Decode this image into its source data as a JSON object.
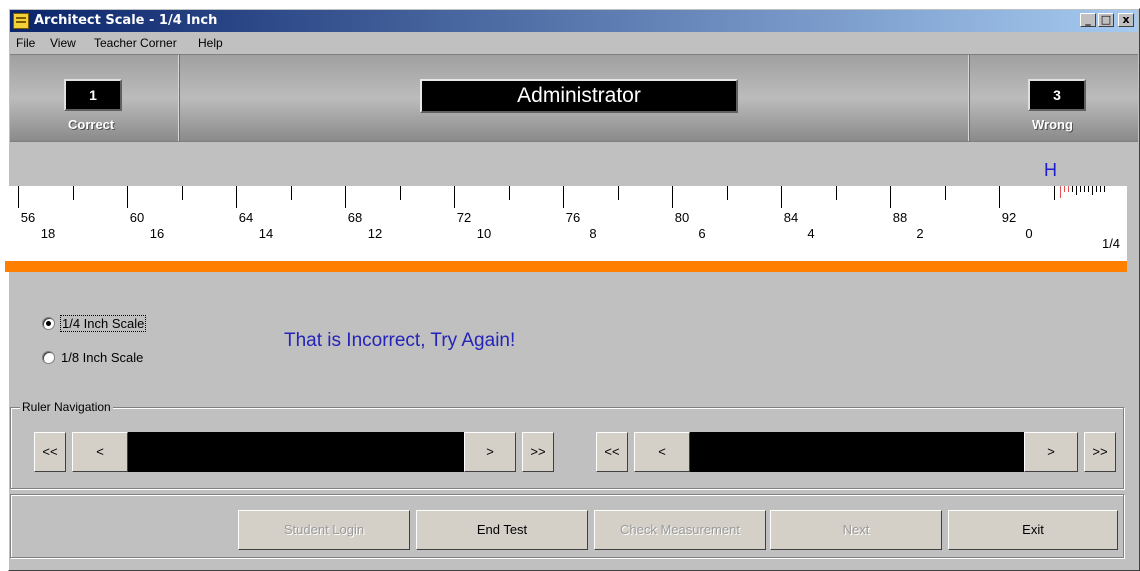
{
  "window": {
    "title": "Architect Scale - 1/4 Inch",
    "controls": {
      "minimize": "_",
      "maximize": "□",
      "close": "x"
    }
  },
  "menu": [
    "File",
    "View",
    "Teacher Corner",
    "Help"
  ],
  "score": {
    "correct_value": "1",
    "correct_label": "Correct",
    "user": "Administrator",
    "wrong_value": "3",
    "wrong_label": "Wrong"
  },
  "ruler": {
    "top_numbers": [
      "56",
      "60",
      "64",
      "68",
      "72",
      "76",
      "80",
      "84",
      "88",
      "92"
    ],
    "bottom_numbers": [
      "18",
      "16",
      "14",
      "12",
      "10",
      "8",
      "6",
      "4",
      "2",
      "0"
    ],
    "scale_label": "1/4",
    "marker": "H",
    "marker_color": "#1e1ecf",
    "band_color": "#ff7f00"
  },
  "scale_options": [
    {
      "label": "1/4 Inch Scale",
      "selected": true
    },
    {
      "label": "1/8 Inch Scale",
      "selected": false
    }
  ],
  "feedback": "That is Incorrect, Try Again!",
  "navigation": {
    "group_label": "Ruler Navigation",
    "left": {
      "first": "<<",
      "prev": "<",
      "next": ">",
      "last": ">>"
    },
    "right": {
      "first": "<<",
      "prev": "<",
      "next": ">",
      "last": ">>"
    }
  },
  "buttons": {
    "student_login": "Student Login",
    "end_test": "End Test",
    "check_measurement": "Check Measurement",
    "next": "Next",
    "exit": "Exit"
  }
}
